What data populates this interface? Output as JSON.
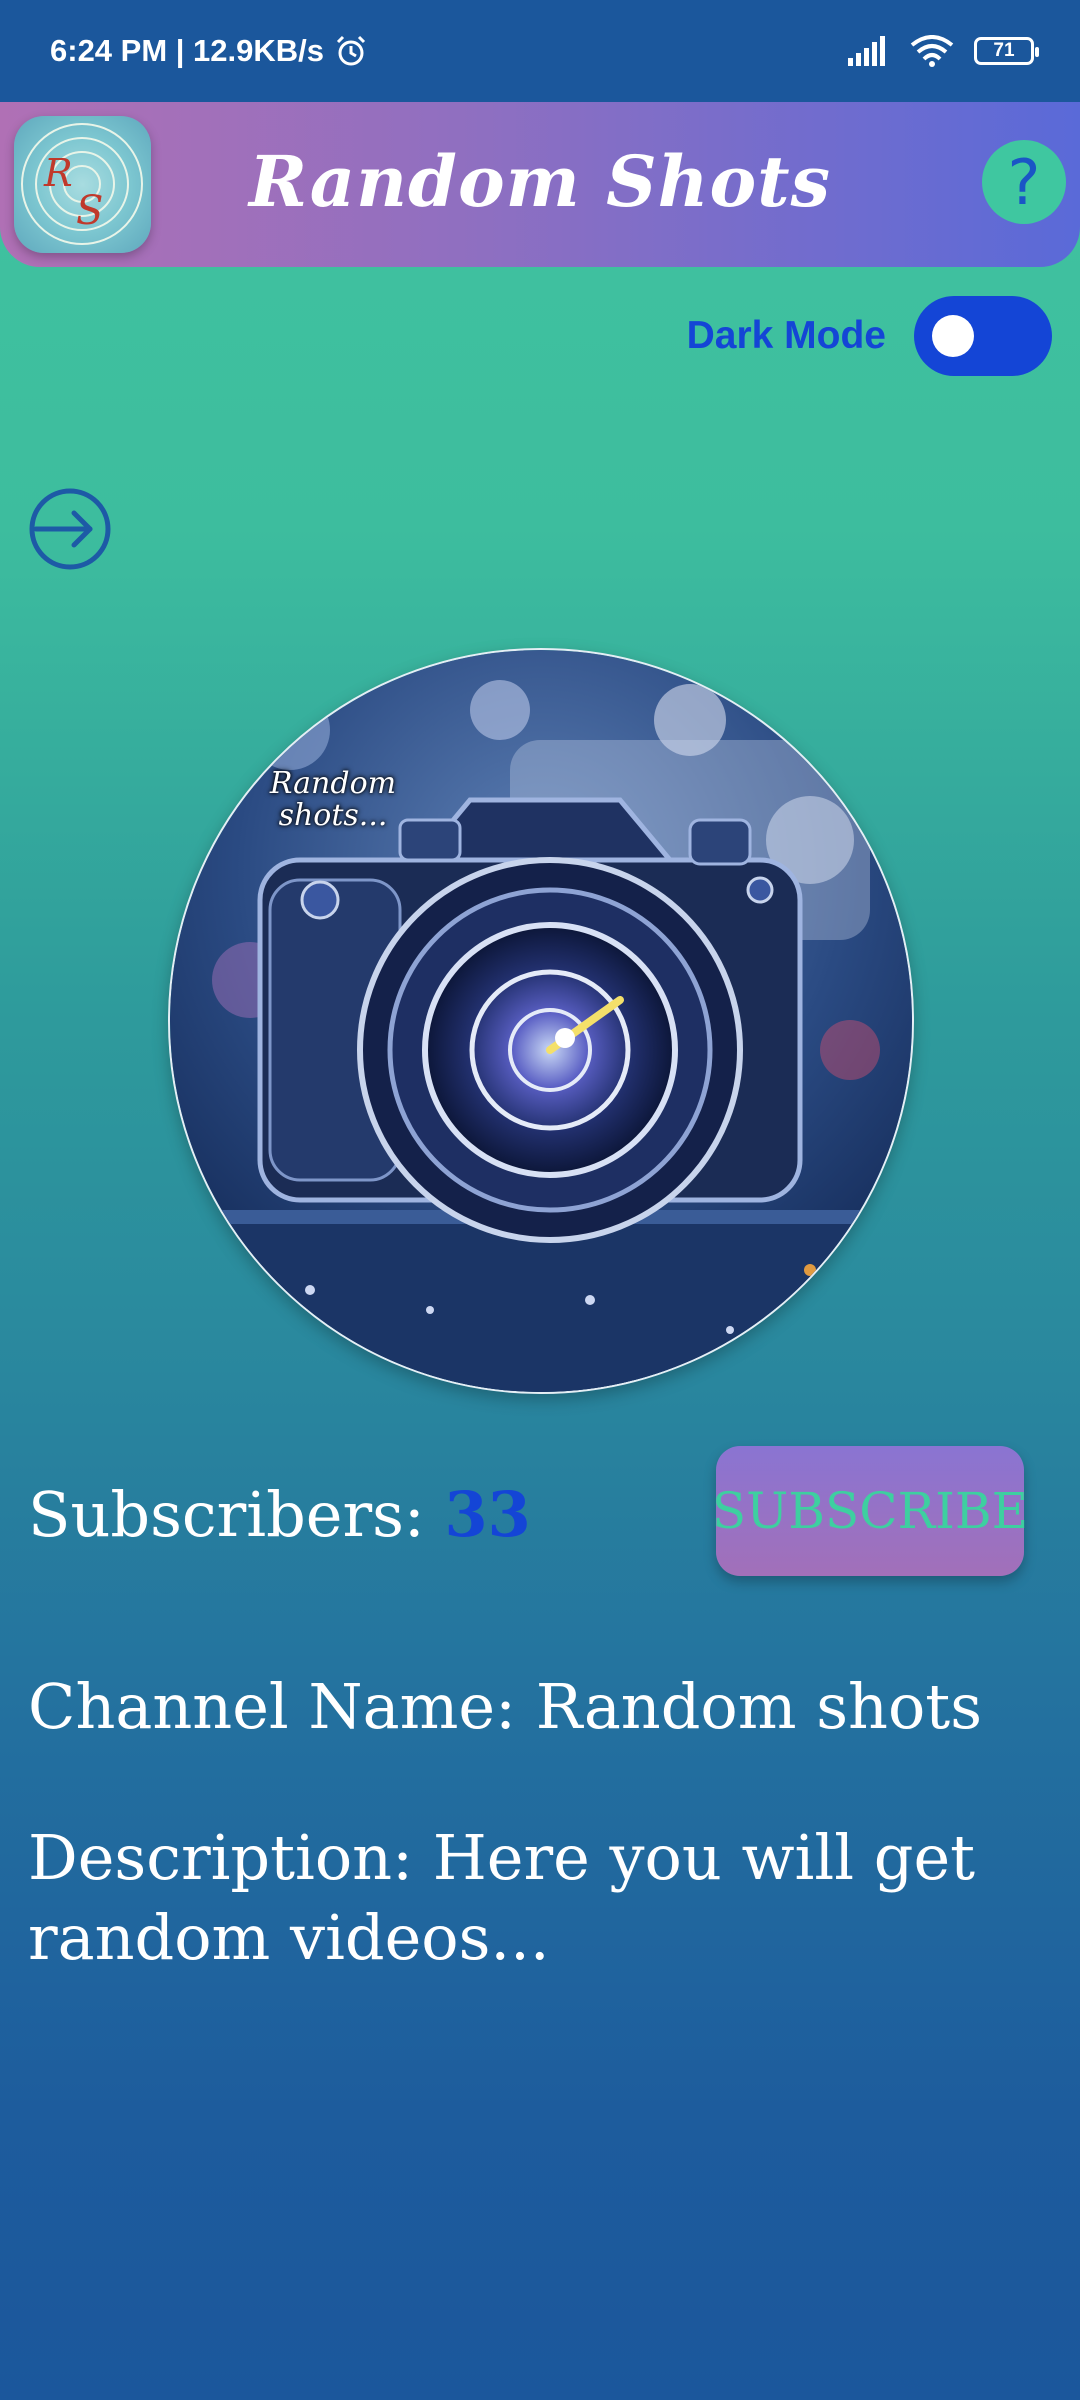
{
  "status_bar": {
    "time": "6:24 PM | 12.9KB/s",
    "battery": "71"
  },
  "app_bar": {
    "title": "Random Shots",
    "help_label": "?"
  },
  "dark_mode": {
    "label": "Dark Mode",
    "enabled": false
  },
  "profile": {
    "watermark": "Random shots..."
  },
  "channel": {
    "subscribers_label": "Subscribers: ",
    "subscribers_count": "33",
    "subscribe_button": "SUBSCRIBE",
    "name_text": "Channel Name: Random shots",
    "description_text": "Description: Here you will get random videos..."
  },
  "colors": {
    "accent_blue": "#1445d6",
    "teal": "#3fc7a0",
    "purple": "#a270b9"
  }
}
